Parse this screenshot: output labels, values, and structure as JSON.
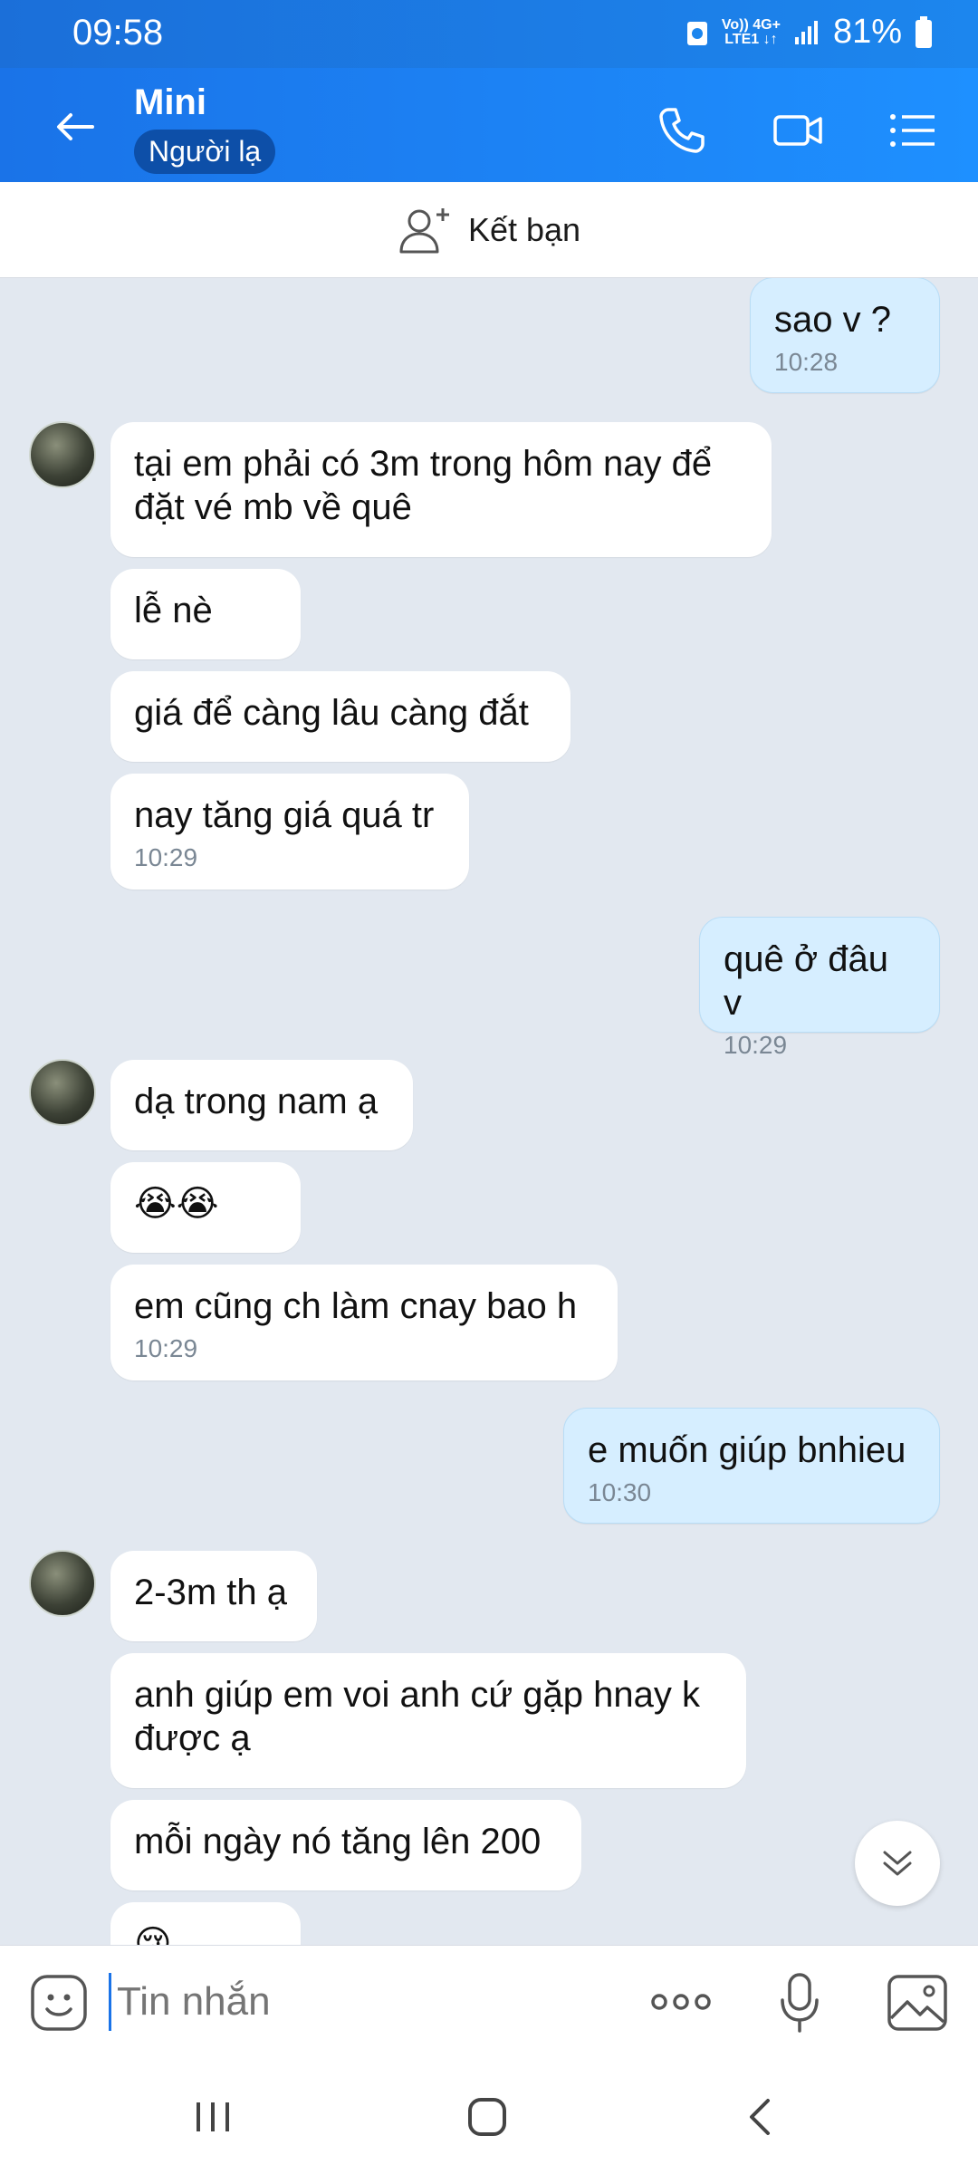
{
  "status_bar": {
    "time": "09:58",
    "net_top": "Vo)) 4G+",
    "net_bottom": "LTE1 ↓↑",
    "battery": "81%"
  },
  "header": {
    "title": "Mini",
    "badge": "Người lạ"
  },
  "add_friend": {
    "label": "Kết bạn"
  },
  "messages": [
    {
      "dir": "out",
      "text": "sao v ?",
      "time": "10:28"
    },
    {
      "dir": "in",
      "text": "tại em phải có 3m trong hôm nay để đặt vé mb về quê",
      "time": ""
    },
    {
      "dir": "in",
      "text": "lễ nè",
      "time": ""
    },
    {
      "dir": "in",
      "text": "giá để càng lâu càng đắt",
      "time": ""
    },
    {
      "dir": "in",
      "text": "nay tăng giá quá tr",
      "time": "10:29"
    },
    {
      "dir": "out",
      "text": "quê ở đâu v",
      "time": "10:29"
    },
    {
      "dir": "in",
      "text": "dạ trong nam ạ",
      "time": ""
    },
    {
      "dir": "in",
      "text": "😭😭",
      "time": ""
    },
    {
      "dir": "in",
      "text": "em cũng ch làm cnay bao h",
      "time": "10:29"
    },
    {
      "dir": "out",
      "text": "e muốn giúp bnhieu",
      "time": "10:30"
    },
    {
      "dir": "in",
      "text": "2-3m th ạ",
      "time": ""
    },
    {
      "dir": "in",
      "text": "anh giúp em voi anh cứ gặp hnay k được ạ",
      "time": ""
    },
    {
      "dir": "in",
      "text": "mỗi ngày nó tăng lên 200",
      "time": ""
    },
    {
      "dir": "in",
      "text": "😢",
      "time": ""
    }
  ],
  "input": {
    "placeholder": "Tin nhắn"
  },
  "colors": {
    "header": "#1a73e8",
    "outgoing_bubble": "#d6eeff",
    "chat_bg": "#e2e8f0"
  }
}
